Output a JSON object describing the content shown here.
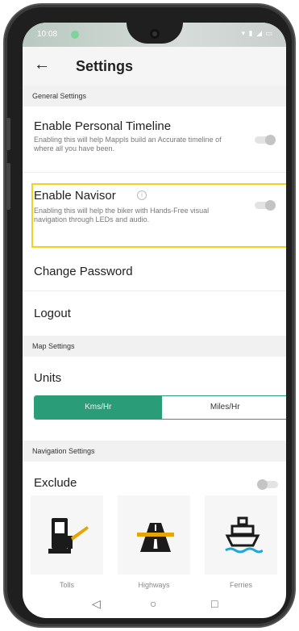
{
  "status_bar": {
    "time": "10:08"
  },
  "header": {
    "back_icon": "arrow-left-icon",
    "title": "Settings"
  },
  "sections": {
    "general": "General Settings",
    "map": "Map Settings",
    "navigation": "Navigation Settings"
  },
  "general_settings": {
    "timeline": {
      "title": "Enable Personal Timeline",
      "description": "Enabling this will help Mappls build an Accurate timeline of where all you have been.",
      "enabled": false
    },
    "navisor": {
      "title": "Enable Navisor",
      "description": "Enabling this will help the biker with Hands-Free visual navigation through LEDs and audio.",
      "enabled": false
    },
    "change_password": "Change Password",
    "logout": "Logout"
  },
  "map_settings": {
    "units_label": "Units",
    "options": [
      "Kms/Hr",
      "Miles/Hr"
    ],
    "selected": "Kms/Hr"
  },
  "navigation_settings": {
    "exclude_label": "Exclude",
    "exclude_enabled": false,
    "items": [
      {
        "label": "Tolls",
        "icon": "toll-booth-icon"
      },
      {
        "label": "Highways",
        "icon": "highway-icon"
      },
      {
        "label": "Ferries",
        "icon": "ferry-icon"
      }
    ]
  },
  "colors": {
    "accent": "#2a9d78",
    "highlight": "#f4d21b"
  }
}
